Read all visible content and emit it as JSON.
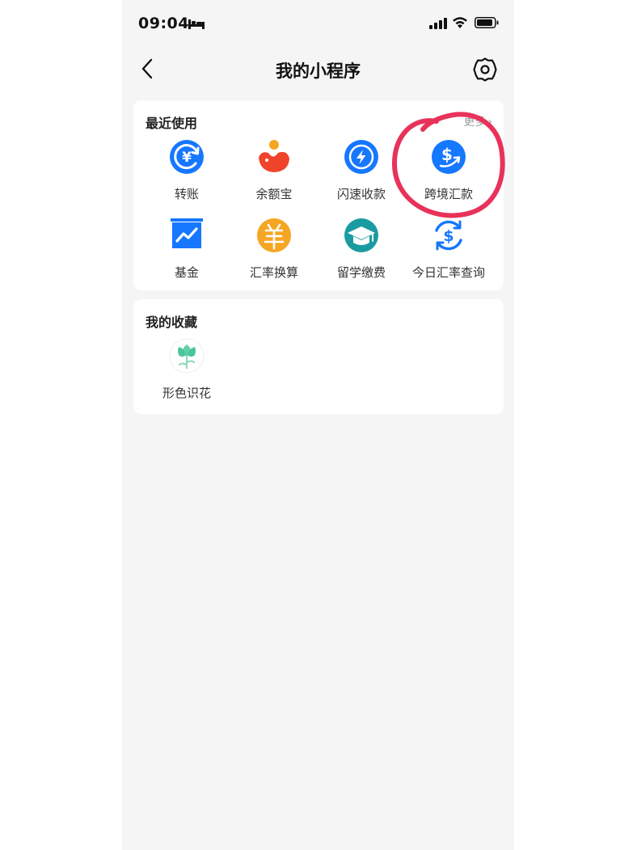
{
  "status_bar": {
    "time": "09:04"
  },
  "nav": {
    "title": "我的小程序"
  },
  "recent": {
    "title": "最近使用",
    "more_label": "更多",
    "items": [
      {
        "label": "转账",
        "icon": "transfer-yuan-icon"
      },
      {
        "label": "余额宝",
        "icon": "yuebao-icon"
      },
      {
        "label": "闪速收款",
        "icon": "lightning-icon"
      },
      {
        "label": "跨境汇款",
        "icon": "dollar-remit-icon"
      },
      {
        "label": "基金",
        "icon": "fund-chart-icon"
      },
      {
        "label": "汇率换算",
        "icon": "yang-icon"
      },
      {
        "label": "留学缴费",
        "icon": "graduation-cap-icon"
      },
      {
        "label": "今日汇率查询",
        "icon": "dollar-refresh-icon"
      }
    ]
  },
  "favorites": {
    "title": "我的收藏",
    "items": [
      {
        "label": "形色识花",
        "icon": "flower-icon"
      }
    ]
  },
  "colors": {
    "accent_blue": "#1677ff",
    "annotation_red": "#e8325a",
    "orange": "#f5a623",
    "teal": "#1a9ba1"
  }
}
